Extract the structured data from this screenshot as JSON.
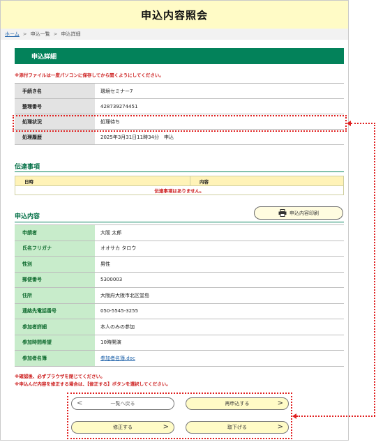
{
  "page_title": "申込内容照会",
  "breadcrumb": {
    "home": "ホーム",
    "list": "申込一覧",
    "detail": "申込詳細",
    "sep": ">"
  },
  "panel_title": "申込詳細",
  "attachment_notice": "※添付ファイルは一度パソコンに保存してから開くようにしてください。",
  "summary": [
    {
      "key": "手続き名",
      "value": "環境セミナー7"
    },
    {
      "key": "整理番号",
      "value": "428739274451"
    },
    {
      "key": "処理状況",
      "value": "処理待ち"
    },
    {
      "key": "処理履歴",
      "value": "2025年3月31日11時34分　申込"
    }
  ],
  "dentatsu": {
    "title": "伝達事項",
    "col_date": "日時",
    "col_content": "内容",
    "empty": "伝達事項はありません。"
  },
  "moushikomi": {
    "title": "申込内容",
    "print_label": "申込内容印刷"
  },
  "details": [
    {
      "key": "申請者",
      "value": "大阪 太郎"
    },
    {
      "key": "氏名フリガナ",
      "value": "オオサカ タロウ"
    },
    {
      "key": "性別",
      "value": "男性"
    },
    {
      "key": "郵便番号",
      "value": "5300003"
    },
    {
      "key": "住所",
      "value": "大阪府大阪市北区堂島"
    },
    {
      "key": "連絡先電話番号",
      "value": "050-5545-3255"
    },
    {
      "key": "参加者詳細",
      "value": "本人のみの参加"
    },
    {
      "key": "参加時間希望",
      "value": "10時開演"
    },
    {
      "key": "参加者名簿",
      "value": "参加者名簿.doc"
    }
  ],
  "footer_notes": [
    "※確認後、必ずブラウザを閉じてください。",
    "※申込んだ内容を修正する場合は、【修正する】ボタンを選択してください。"
  ],
  "buttons": {
    "back": "一覧へ戻る",
    "reapply": "再申込する",
    "edit": "修正する",
    "withdraw": "取下げる"
  },
  "colors": {
    "accent_green": "#03825a",
    "title_yellow": "#fffbc6",
    "highlight_red": "#e02020"
  }
}
